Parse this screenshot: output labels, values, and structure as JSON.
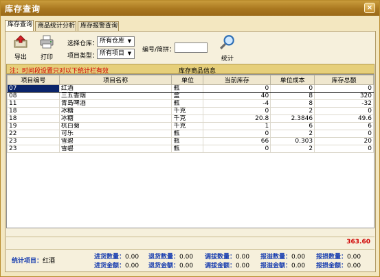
{
  "window": {
    "title": "库存查询",
    "close_glyph": "×"
  },
  "tabs": [
    {
      "label": "库存查询",
      "active": true
    },
    {
      "label": "商品统计分析",
      "active": false
    },
    {
      "label": "库存报警查询",
      "active": false
    }
  ],
  "toolbar": {
    "export_label": "导出",
    "print_label": "打印",
    "stats_label": "统计"
  },
  "filters": {
    "warehouse_label": "选择仓库：",
    "warehouse_value": "所有仓库",
    "type_label": "项目类型：",
    "type_value": "所有项目",
    "code_label": "编号/简拼：",
    "code_value": ""
  },
  "infobar": {
    "note": "注：时间段设置只对以下统计栏有效",
    "center": "库存商品信息"
  },
  "table": {
    "headers": [
      "项目编号",
      "项目名称",
      "单位",
      "当前库存",
      "单位成本",
      "库存总额"
    ],
    "rows": [
      [
        "07",
        "红酒",
        "瓶",
        "0",
        "0",
        "0"
      ],
      [
        "08",
        "三五香烟",
        "盒",
        "40",
        "8",
        "320"
      ],
      [
        "11",
        "青岛啤酒",
        "瓶",
        "-4",
        "8",
        "-32"
      ],
      [
        "18",
        "冰糖",
        "千克",
        "0",
        "2",
        "0"
      ],
      [
        "18",
        "冰糖",
        "千克",
        "20.8",
        "2.3846",
        "49.6"
      ],
      [
        "19",
        "杭白菊",
        "千克",
        "1",
        "6",
        "6"
      ],
      [
        "22",
        "可乐",
        "瓶",
        "0",
        "2",
        "0"
      ],
      [
        "23",
        "雪碧",
        "瓶",
        "66",
        "0.303",
        "20"
      ],
      [
        "23",
        "雪碧",
        "瓶",
        "0",
        "2",
        "0"
      ]
    ]
  },
  "total": "363.60",
  "stats": {
    "item_label": "统计项目：",
    "item_value": "红酒",
    "purchase_qty_label": "进货数量：",
    "purchase_qty": "0.00",
    "purchase_amt_label": "进货金额：",
    "purchase_amt": "0.00",
    "return_qty_label": "退货数量：",
    "return_qty": "0.00",
    "return_amt_label": "退货金额：",
    "return_amt": "0.00",
    "transfer_qty_label": "调拔数量：",
    "transfer_qty": "0.00",
    "transfer_amt_label": "调拔金额：",
    "transfer_amt": "0.00",
    "overflow_qty_label": "报溢数量：",
    "overflow_qty": "0.00",
    "overflow_amt_label": "报溢金额：",
    "overflow_amt": "0.00",
    "loss_qty_label": "报损数量：",
    "loss_qty": "0.00",
    "loss_amt_label": "报损金额：",
    "loss_amt": "0.00"
  },
  "colors": {
    "title_bar": "#a9771f",
    "note_red": "#d00000",
    "stat_blue": "#1a3fb0",
    "selected_cell": "#0a246a"
  }
}
